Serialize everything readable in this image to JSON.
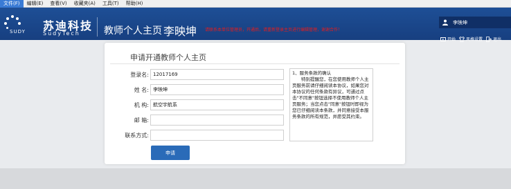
{
  "menu": [
    "文件(F)",
    "编辑(E)",
    "查看(V)",
    "收藏夹(A)",
    "工具(T)",
    "帮助(H)"
  ],
  "header": {
    "logo_cn": "苏迪科技",
    "logo_en": "SudyTech",
    "logo_mark": "SUDY",
    "page_title": "教师个人主页",
    "owner_name": "李映坤",
    "notice": "请联系本单位管理员，开通后，请重新登录主页进行编辑管理，谢谢合作！",
    "user_name": "李映坤",
    "actions": [
      "开始",
      "风格设置",
      "退出"
    ],
    "colors": {
      "banner": "#1e4f96",
      "notice": "#e81c1c"
    }
  },
  "form": {
    "title": "申请开通教师个人主页",
    "fields": [
      {
        "label": "登录名:",
        "value": "12017169"
      },
      {
        "label": "姓  名:",
        "value": "李映坤"
      },
      {
        "label": "机  构:",
        "value": "航空宇航系"
      },
      {
        "label": "邮  箱:",
        "value": ""
      },
      {
        "label": "联系方式:",
        "value": ""
      }
    ],
    "terms_heading": "1、服务条款的确认",
    "terms_body": "特别提醒您，在您使用教师个人主页服务前请仔细阅读本协议，如果您对本协议的任何条款有异议，可通过点击\"不同意\"按钮选择不使用教师个人主页服务；当您点击\"同意\"按钮时即视为您已仔细阅读本条款，并同意接受本服务条款的所有规范，并愿受其约束。",
    "submit_label": "申请",
    "colors": {
      "button": "#2a6bb8"
    }
  }
}
